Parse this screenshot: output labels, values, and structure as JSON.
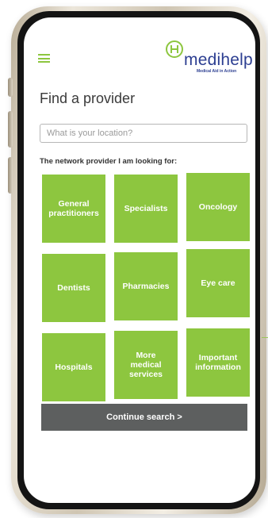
{
  "header": {
    "brand_name": "medihelp",
    "brand_tagline": "Medical Aid in Action",
    "brand_color": "#2c3e91",
    "menu_icon": "hamburger-menu-icon"
  },
  "page": {
    "title": "Find a provider",
    "accent_color": "#8dc63f"
  },
  "search": {
    "placeholder": "What is your location?",
    "value": ""
  },
  "provider_section": {
    "label": "The network provider I am looking for:",
    "tiles": [
      "General\npractitioners",
      "Specialists",
      "Oncology",
      "Dentists",
      "Pharmacies",
      "Eye care",
      "Hospitals",
      "More\nmedical\nservices",
      "Important\ninformation"
    ]
  },
  "actions": {
    "continue_label": "Continue search >",
    "continue_color": "#5d5f5f"
  }
}
